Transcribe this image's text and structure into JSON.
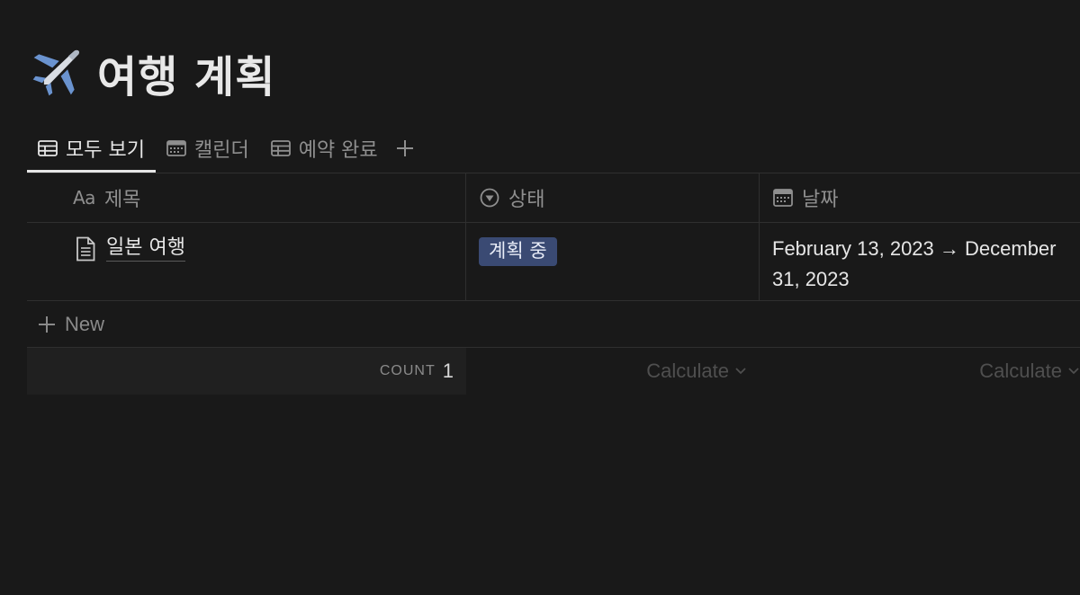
{
  "page": {
    "title": "여행 계획",
    "icon": "airplane-icon"
  },
  "tabs": [
    {
      "label": "모두 보기",
      "icon": "table-icon",
      "active": true
    },
    {
      "label": "캘린더",
      "icon": "calendar-icon",
      "active": false
    },
    {
      "label": "예약 완료",
      "icon": "table-icon",
      "active": false
    }
  ],
  "columns": [
    {
      "label": "제목",
      "icon": "Aa"
    },
    {
      "label": "상태",
      "icon": "status-icon"
    },
    {
      "label": "날짜",
      "icon": "calendar-icon"
    }
  ],
  "rows": [
    {
      "title": "일본 여행",
      "status": "계획 중",
      "date": "February 13, 2023 → December 31, 2023"
    }
  ],
  "new_label": "New",
  "footer": {
    "count_label": "COUNT",
    "count_value": "1",
    "calculate_label": "Calculate"
  },
  "colors": {
    "background": "#191919",
    "status_badge_bg": "#3a4a73"
  }
}
